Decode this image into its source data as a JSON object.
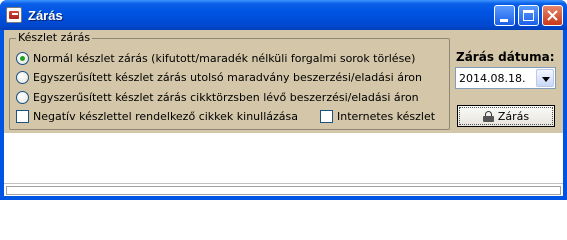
{
  "window": {
    "title": "Zárás",
    "icon": "report-icon",
    "colors": {
      "titlebar": "#0054e3",
      "panel": "#d4c7a9",
      "radio_check": "#21a121"
    }
  },
  "group": {
    "legend": "Készlet zárás",
    "options": [
      {
        "label": "Normál készlet zárás (kifutott/maradék nélküli forgalmi sorok törlése)",
        "selected": true
      },
      {
        "label": "Egyszerűsített készlet zárás utolsó maradvány beszerzési/eladási áron",
        "selected": false
      },
      {
        "label": "Egyszerűsített készlet zárás cikktörzsben lévő beszerzési/eladási áron",
        "selected": false
      }
    ],
    "checkbox_negative": {
      "label": "Negatív készlettel rendelkező cikkek kinullázása",
      "checked": false
    },
    "checkbox_internet": {
      "label": "Internetes készlet",
      "checked": false
    }
  },
  "date": {
    "title": "Zárás dátuma:",
    "value": "2014.08.18."
  },
  "actions": {
    "zaras_label": "Zárás",
    "zaras_icon": "lock-icon"
  }
}
